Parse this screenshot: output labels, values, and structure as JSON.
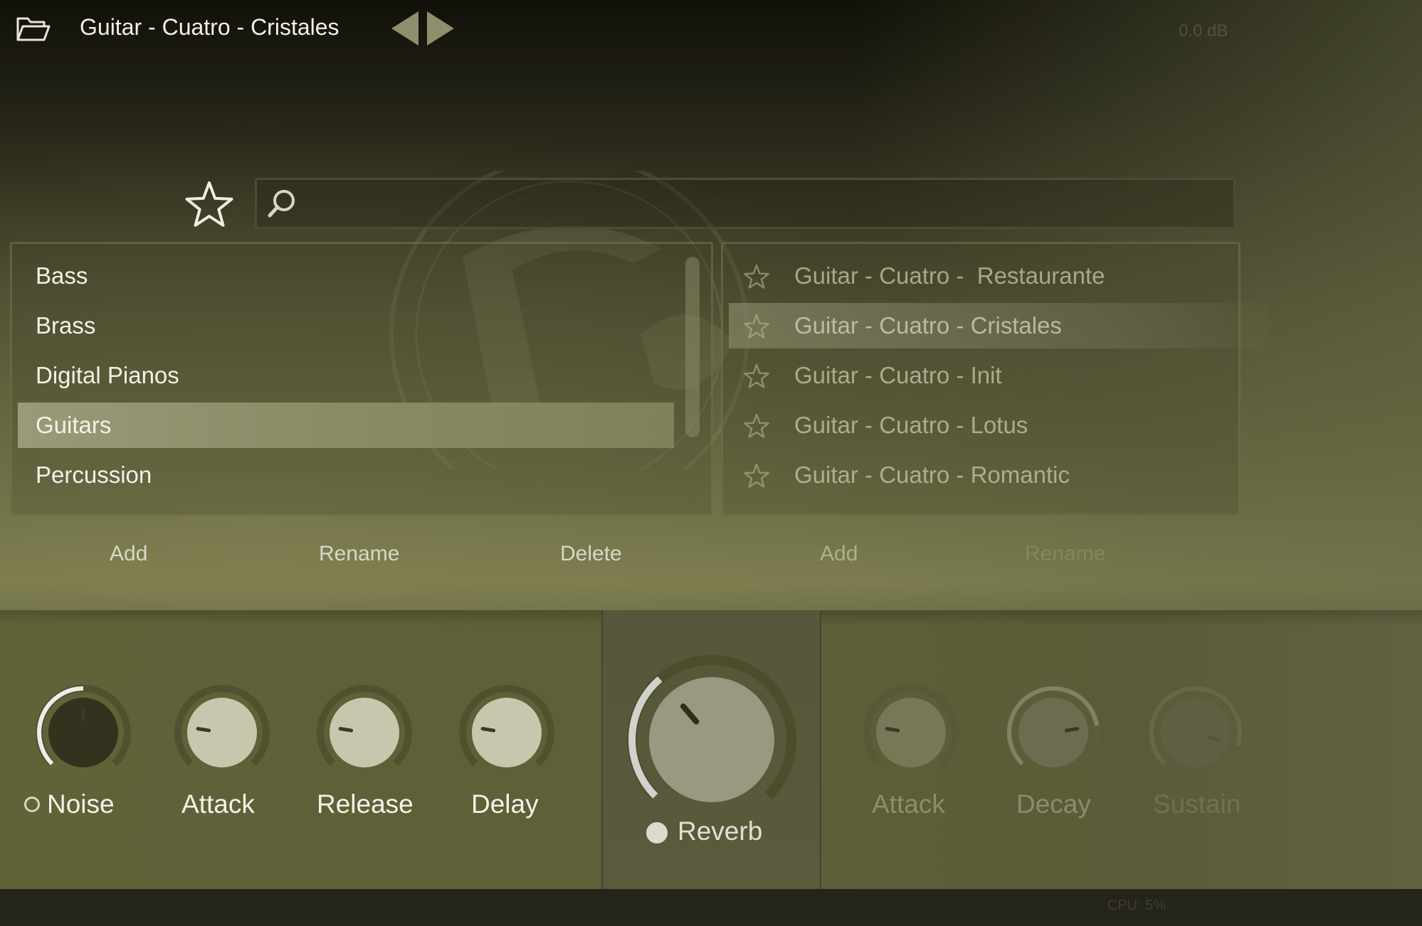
{
  "header": {
    "preset_name": "Guitar - Cuatro - Cristales",
    "folder_icon": "folder-open-icon",
    "prev_icon": "triangle-left-icon",
    "next_icon": "triangle-right-icon",
    "output_level": "0.0 dB"
  },
  "search": {
    "placeholder": "",
    "value": "",
    "icon": "search-icon",
    "favorites_icon": "star-outline-icon"
  },
  "categories": {
    "items": [
      "Bass",
      "Brass",
      "Digital Pianos",
      "Guitars",
      "Percussion"
    ],
    "selected": "Guitars"
  },
  "presets": {
    "items": [
      "Guitar - Cuatro -  Restaurante",
      "Guitar - Cuatro - Cristales",
      "Guitar - Cuatro - Init",
      "Guitar - Cuatro - Lotus",
      "Guitar - Cuatro - Romantic"
    ],
    "selected": "Guitar - Cuatro - Cristales"
  },
  "category_actions": {
    "add": "Add",
    "rename": "Rename",
    "delete": "Delete"
  },
  "preset_actions": {
    "add": "Add",
    "rename": "Rename"
  },
  "controls": {
    "noise": {
      "label": "Noise",
      "value": 0.5,
      "enabled": false
    },
    "attack": {
      "label": "Attack",
      "value": 0.2
    },
    "release": {
      "label": "Release",
      "value": 0.2
    },
    "delay": {
      "label": "Delay",
      "value": 0.2
    },
    "reverb": {
      "label": "Reverb",
      "value": 0.35,
      "enabled": true
    },
    "env_attack": {
      "label": "Attack",
      "value": 0.2
    },
    "env_decay": {
      "label": "Decay",
      "value": 0.8
    },
    "env_sustain": {
      "label": "Sustain",
      "value": 0.9
    }
  },
  "footer": {
    "cpu": "CPU: 5%"
  },
  "colors": {
    "accent_text": "#f2f0e6",
    "selection": "#999a78",
    "panel_bg": "#5e5e38"
  }
}
